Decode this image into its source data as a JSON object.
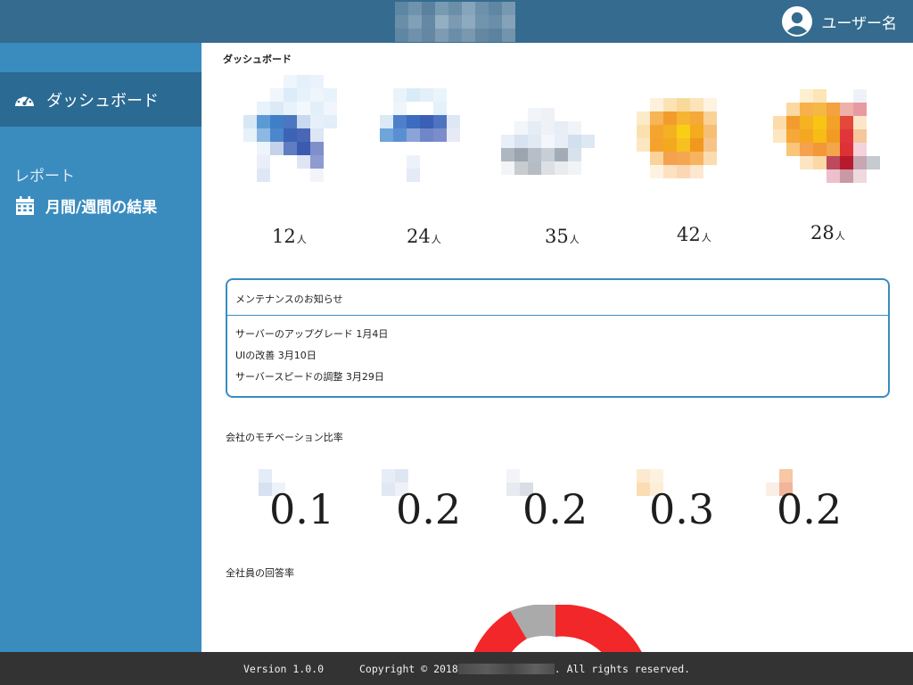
{
  "header": {
    "brand_logo_alt": "logo-redacted",
    "user_name": "ユーザー名",
    "user_icon": "user-circle-icon"
  },
  "sidebar": {
    "dashboard_label": "ダッシュボード",
    "dashboard_icon": "speedometer-icon",
    "report_heading": "レポート",
    "monthly_label": "月間/週間の結果",
    "monthly_icon": "calendar-icon",
    "colors": {
      "background": "#3a8cbf",
      "active": "#2b6a92"
    }
  },
  "dashboard": {
    "title": "ダッシュボード",
    "counts": [
      {
        "value": "12",
        "unit": "人"
      },
      {
        "value": "24",
        "unit": "人"
      },
      {
        "value": "35",
        "unit": "人"
      },
      {
        "value": "42",
        "unit": "人"
      },
      {
        "value": "28",
        "unit": "人"
      }
    ]
  },
  "maintenance": {
    "title": "メンテナンスのお知らせ",
    "items": [
      "サーバーのアップグレード 1月4日",
      "UIの改善 3月10日",
      "サーバースピードの調整 3月29日"
    ]
  },
  "motivation": {
    "title": "会社のモチベーション比率",
    "ratios": [
      "0.1",
      "0.2",
      "0.2",
      "0.3",
      "0.2"
    ]
  },
  "response": {
    "title": "全社員の回答率"
  },
  "footer": {
    "version": "Version 1.0.0",
    "copyright_prefix": "Copyright © 2018",
    "copyright_suffix": ". All rights reserved."
  },
  "colors": {
    "header": "#346b8e",
    "footer": "#333333",
    "accent": "#3a8cbf",
    "donut_red": "#f2272a",
    "donut_gray": "#aaaaaa"
  }
}
